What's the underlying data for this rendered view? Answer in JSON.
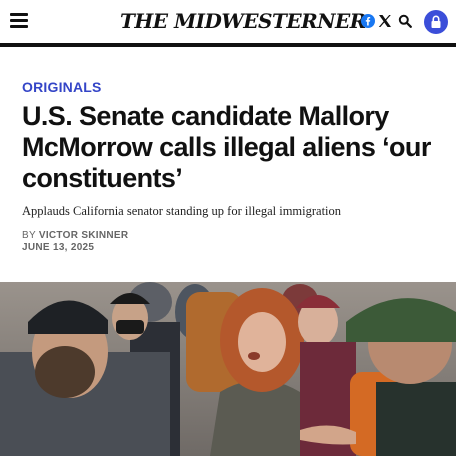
{
  "header": {
    "logo_text": "THE MIDWESTERNER",
    "menu_icon": "hamburger-menu-icon",
    "social_icons": [
      "facebook-icon",
      "x-icon"
    ],
    "search_icon": "search-icon",
    "account_icon": "lock-icon",
    "accent_color": "#3b4ed9"
  },
  "article": {
    "category": "ORIGINALS",
    "headline": "U.S. Senate candidate Mallory McMorrow calls illegal aliens ‘our constituents’",
    "dek": "Applauds California senator standing up for illegal immigration",
    "byline_prefix": "BY ",
    "author": "VICTOR SKINNER",
    "date": "JUNE 13, 2025"
  },
  "photo": {
    "subject": "woman-speaking-among-crowd"
  }
}
